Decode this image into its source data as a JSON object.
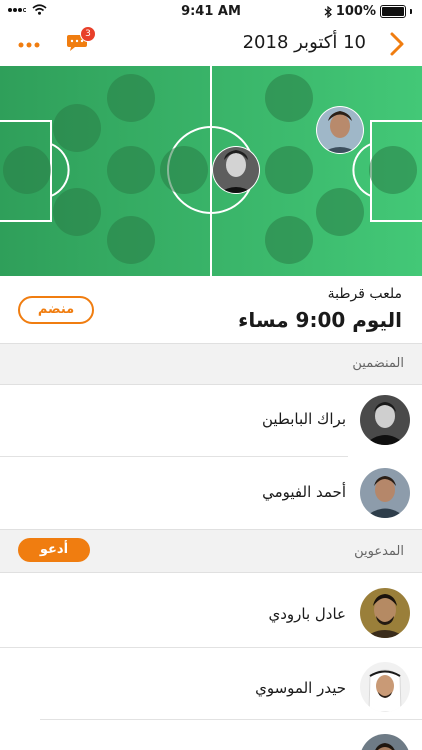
{
  "status_bar": {
    "time": "9:41 AM",
    "battery": "100%"
  },
  "nav": {
    "title": "10 أكتوبر 2018",
    "more_icon": "more-dots-icon",
    "chat_badge": "3",
    "back_icon": "chevron-right-icon"
  },
  "match": {
    "venue": "ملعب قرطبة",
    "time": "اليوم 9:00 مساء",
    "join_label": "منضم"
  },
  "joined": {
    "title": "المنضمين",
    "players": [
      {
        "name": "براك البابطين"
      },
      {
        "name": "أحمد الفيومي"
      }
    ]
  },
  "invited": {
    "title": "المدعوين",
    "invite_label": "أدعو",
    "players": [
      {
        "name": "عادل بارودي"
      },
      {
        "name": "حيدر الموسوي"
      }
    ]
  },
  "colors": {
    "accent": "#f07d10",
    "pitch": "#3fb96d",
    "badge": "#e8402a"
  }
}
